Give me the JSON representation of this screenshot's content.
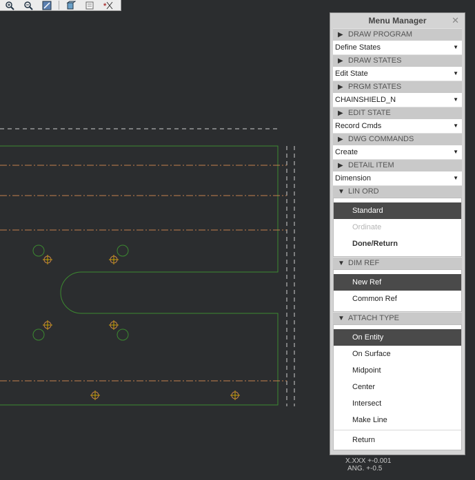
{
  "toolbar": {
    "icons": [
      "zoom-in-icon",
      "zoom-out-icon",
      "repaint-icon",
      "view-3d-icon",
      "saved-views-icon",
      "datum-display-icon"
    ]
  },
  "menu_manager": {
    "title": "Menu Manager",
    "close_glyph": "✕",
    "sections": [
      {
        "header": "DRAW PROGRAM",
        "value": "Define States"
      },
      {
        "header": "DRAW STATES",
        "value": "Edit State"
      },
      {
        "header": "PRGM STATES",
        "value": "CHAINSHIELD_N"
      },
      {
        "header": "EDIT STATE",
        "value": "Record Cmds"
      },
      {
        "header": "DWG COMMANDS",
        "value": "Create"
      },
      {
        "header": "DETAIL ITEM",
        "value": "Dimension"
      }
    ],
    "lin_ord": {
      "header": "LIN ORD",
      "items": [
        "Standard",
        "Ordinate",
        "Done/Return"
      ]
    },
    "dim_ref": {
      "header": "DIM REF",
      "items": [
        "New Ref",
        "Common Ref"
      ]
    },
    "attach_type": {
      "header": "ATTACH TYPE",
      "items": [
        "On Entity",
        "On Surface",
        "Midpoint",
        "Center",
        "Intersect",
        "Make Line"
      ],
      "return_label": "Return"
    }
  },
  "status": {
    "tolerance_line1": "X.XXX +-0.001",
    "tolerance_line2": "ANG.  +-0.5"
  },
  "colors": {
    "background": "#2b2d2f",
    "geometry": "#3c8a30",
    "centerline": "#c4814d",
    "dashed": "#cfcfcf",
    "selected_item": "#4a4a4a"
  }
}
